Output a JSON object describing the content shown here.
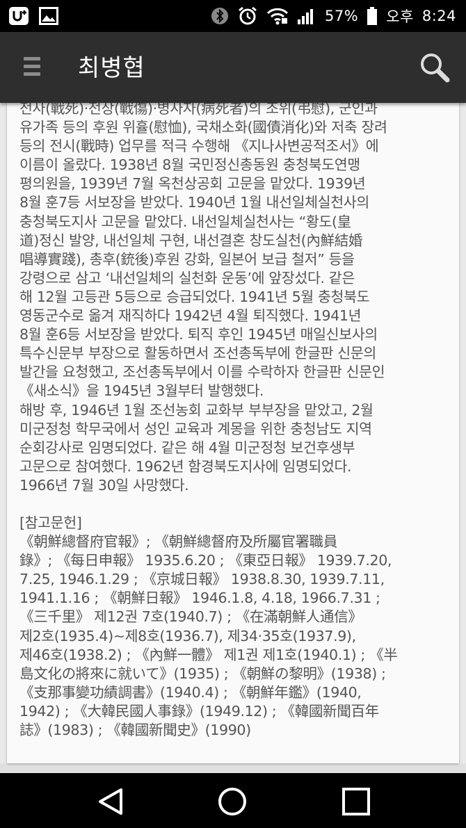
{
  "status_bar": {
    "battery_percent": "57%",
    "time_prefix": "오후",
    "time": "8:24",
    "icons": [
      "u-plus-icon",
      "image-icon",
      "bluetooth-icon",
      "alarm-icon",
      "wifi-icon",
      "signal-icon",
      "battery-icon"
    ]
  },
  "toolbar": {
    "title": "최병협",
    "menu_icon": "menu-icon",
    "search_icon": "search-icon"
  },
  "article": {
    "lines": [
      "전사(戰死)·전상(戰傷)·병사자(病死者)의 조위(弔慰), 군인과",
      "유가족 등의 후원 위휼(慰恤), 국채소화(國債消化)와 저축 장려",
      "등의 전시(戰時) 업무를 적극 수행해 《지나사변공적조서》에",
      "이름이 올랐다. 1938년 8월 국민정신총동원 충청북도연맹",
      "평의원을, 1939년 7월 옥천상공회 고문을 맡았다. 1939년",
      "8월 훈7등 서보장을 받았다. 1940년 1월 내선일체실천사의",
      "충청북도지사 고문을 맡았다. 내선일체실천사는 “황도(皇",
      "道)정신 발양, 내선일체 구현, 내선결혼 창도실천(內鮮結婚",
      "唱導實踐), 총후(銃後)후원 강화, 일본어 보급 철저” 등을",
      "강령으로 삼고 ‘내선일체의 실천화 운동’에 앞장섰다. 같은",
      "해 12월 고등관 5등으로 승급되었다. 1941년 5월 충청북도",
      "영동군수로 옮겨 재직하다 1942년 4월 퇴직했다. 1941년",
      "8월 훈6등 서보장을 받았다. 퇴직 후인 1945년 매일신보사의",
      "특수신문부 부장으로 활동하면서 조선총독부에 한글판 신문의",
      "발간을 요청했고, 조선총독부에서 이를 수락하자 한글판 신문인",
      "《새소식》을 1945년 3월부터 발행했다.",
      "해방 후, 1946년 1월 조선농회 교화부 부부장을 맡았고, 2월",
      "미군정청 학무국에서 성인 교육과 계몽을 위한 충청남도 지역",
      "순회강사로 임명되었다. 같은 해 4월 미군정청 보건후생부",
      "고문으로 참여했다. 1962년 함경북도지사에 임명되었다.",
      "1966년 7월 30일 사망했다."
    ],
    "references_heading": "[참고문헌]",
    "references_lines": [
      "《朝鮮總督府官報》; 《朝鮮總督府及所屬官署職員",
      "錄》; 《每日申報》 1935.6.20 ; 《東亞日報》 1939.7.20,",
      "7.25, 1946.1.29 ; 《京城日報》 1938.8.30, 1939.7.11,",
      "1941.1.16 ; 《朝鮮日報》 1946.1.8, 4.18, 1966.7.31 ;",
      "《三千里》 제12권 7호(1940.7) ; 《在滿朝鮮人通信》",
      "제2호(1935.4)~제8호(1936.7), 제34·35호(1937.9),",
      "제46호(1938.2) ; 《內鮮一體》 제1권 제1호(1940.1) ; 《半",
      "島文化の將來に就いて》(1935) ; 《朝鮮の黎明》(1938) ;",
      "《支那事變功績調書》(1940.4) ; 《朝鮮年鑑》(1940,",
      "1942) ; 《大韓民國人事錄》(1949.12) ; 《韓國新聞百年",
      "誌》(1983) ; 《韓國新聞史》(1990)"
    ]
  },
  "nav_bar": {
    "icons": [
      "back-icon",
      "home-icon",
      "recents-icon"
    ]
  }
}
